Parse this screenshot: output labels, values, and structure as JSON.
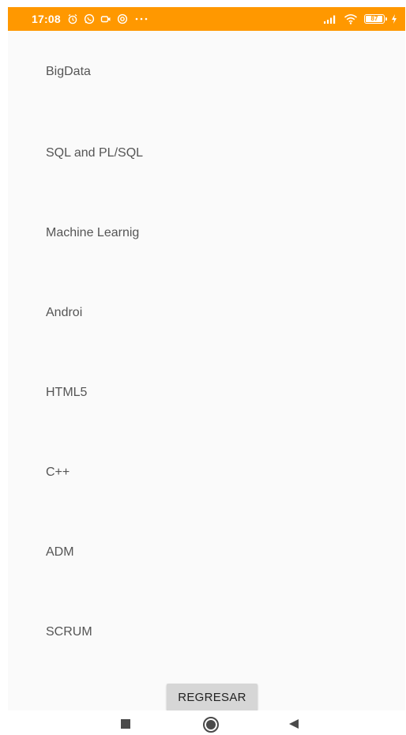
{
  "status_bar": {
    "time": "17:08",
    "battery_level": "87",
    "background_color": "#ff9800",
    "left_icons": [
      "alarm-icon",
      "whatsapp-icon",
      "video-icon",
      "circle-app-icon",
      "more-dots-icon"
    ],
    "right_icons": [
      "signal-icon",
      "wifi-icon",
      "battery-icon",
      "charging-icon"
    ]
  },
  "course_list": {
    "items": [
      {
        "label": "BigData"
      },
      {
        "label": "SQL and PL/SQL"
      },
      {
        "label": "Machine Learnig"
      },
      {
        "label": "Androi"
      },
      {
        "label": "HTML5"
      },
      {
        "label": "C++"
      },
      {
        "label": "ADM"
      },
      {
        "label": "SCRUM"
      }
    ]
  },
  "actions": {
    "back_label": "REGRESAR"
  },
  "nav_bar": {
    "buttons": [
      "recents-icon",
      "home-icon",
      "back-icon"
    ]
  }
}
